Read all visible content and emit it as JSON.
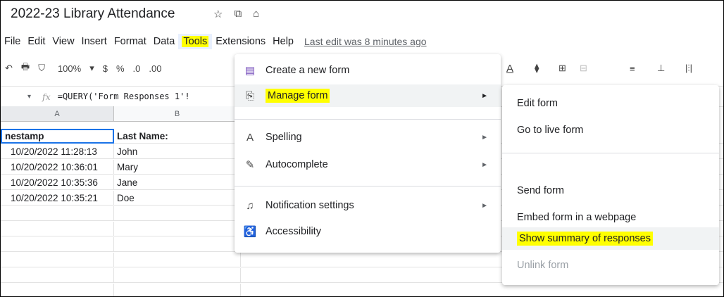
{
  "doc": {
    "title": "2022-23 Library Attendance",
    "star_icon": "☆",
    "move_icon": "⧉",
    "cloud_icon": "⌂"
  },
  "menubar": {
    "items": [
      "File",
      "Edit",
      "View",
      "Insert",
      "Format",
      "Data",
      "Tools",
      "Extensions",
      "Help"
    ],
    "last_edit": "Last edit was 8 minutes ago"
  },
  "toolbar": {
    "undo": "↶",
    "print": "🖶",
    "paint": "⛉",
    "zoom": "100%",
    "zoom_arrow": "▾",
    "currency": "$",
    "percent": "%",
    "dec_less": ".0",
    "dec_more": ".00",
    "text_color": "A",
    "fill": "⧫",
    "borders": "⊞",
    "merge": "⊟",
    "align": "≡",
    "valign": "⊥",
    "wrap": "|⫶|"
  },
  "formulabar": {
    "cell_arrow": "▾",
    "fx": "fx",
    "formula": "=QUERY('Form Responses 1'!"
  },
  "columns": [
    "A",
    "B"
  ],
  "table": {
    "headers": [
      "nestamp",
      "Last Name:"
    ],
    "rows": [
      [
        "10/20/2022 11:28:13",
        "John"
      ],
      [
        "10/20/2022 10:36:01",
        "Mary"
      ],
      [
        "10/20/2022 10:35:36",
        "Jane"
      ],
      [
        "10/20/2022 10:35:21",
        "Doe"
      ]
    ]
  },
  "tools_menu": {
    "items": [
      {
        "label": "Create a new form",
        "icon": "▤"
      },
      {
        "label": "Manage form",
        "icon": "⎘"
      },
      {
        "label": "Spelling",
        "icon": "A"
      },
      {
        "label": "Autocomplete",
        "icon": "✎"
      },
      {
        "label": "Notification settings",
        "icon": "♫"
      },
      {
        "label": "Accessibility",
        "icon": "♿"
      }
    ],
    "submenu_arrow": "►"
  },
  "manage_form_submenu": {
    "items": [
      "Edit form",
      "Go to live form",
      "Send form",
      "Embed form in a webpage",
      "Show summary of responses",
      "Unlink form"
    ]
  },
  "colors": {
    "highlight": "#ffff00",
    "selection": "#1a73e8"
  }
}
